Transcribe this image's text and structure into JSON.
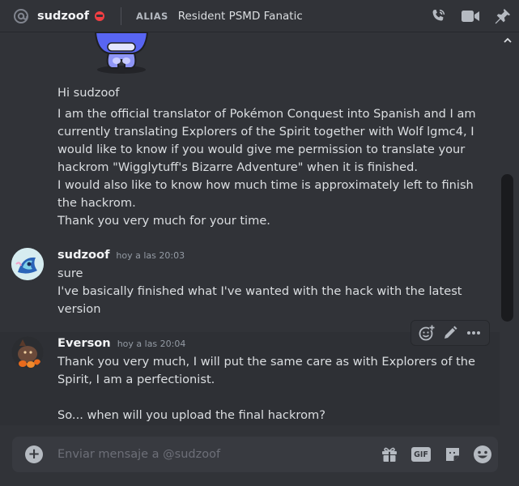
{
  "header": {
    "username": "sudzoof",
    "alias_label": "ALIAS",
    "alias_value": "Resident PSMD Fanatic"
  },
  "messages": {
    "first": {
      "lines": [
        "Hi sudzoof",
        "I am the official translator of Pokémon Conquest into Spanish and I am",
        "currently translating Explorers of the Spirit together with Wolf lgmc4, I",
        "would like to know if you would give me permission to translate your",
        "hackrom \"Wigglytuff's Bizarre Adventure\" when it is finished.",
        "I would also like to know how much time is approximately left to finish",
        "the hackrom.",
        "Thank you very much for your time."
      ]
    },
    "second": {
      "author": "sudzoof",
      "timestamp": "hoy a las 20:03",
      "lines": [
        "sure",
        "I've basically finished what I've wanted with the hack with the latest",
        "version"
      ]
    },
    "third": {
      "author": "Everson",
      "timestamp": "hoy a las 20:04",
      "lines": [
        "Thank you very much, I will put the same care as with Explorers of the",
        "Spirit, I am a perfectionist.",
        "",
        "So... when will you upload the final hackrom?"
      ]
    }
  },
  "composer": {
    "placeholder": "Enviar mensaje a @sudzoof",
    "value": "",
    "gif_label": "GIF"
  },
  "icons": {
    "header_left": "at-sign-icon",
    "status": "do-not-disturb-icon",
    "header_actions": [
      "voice-call-icon",
      "video-call-icon",
      "pin-icon"
    ],
    "message_toolbar": [
      "add-reaction-icon",
      "edit-icon",
      "more-icon"
    ],
    "composer": [
      "add-attachment-icon",
      "gift-icon",
      "gif-icon",
      "sticker-icon",
      "emoji-icon"
    ]
  },
  "colors": {
    "background": "#313338",
    "composer_bg": "#383a40",
    "dnd_status": "#f23f43",
    "username_text": "#f2f3f5",
    "timestamp_text": "#949ba4"
  }
}
